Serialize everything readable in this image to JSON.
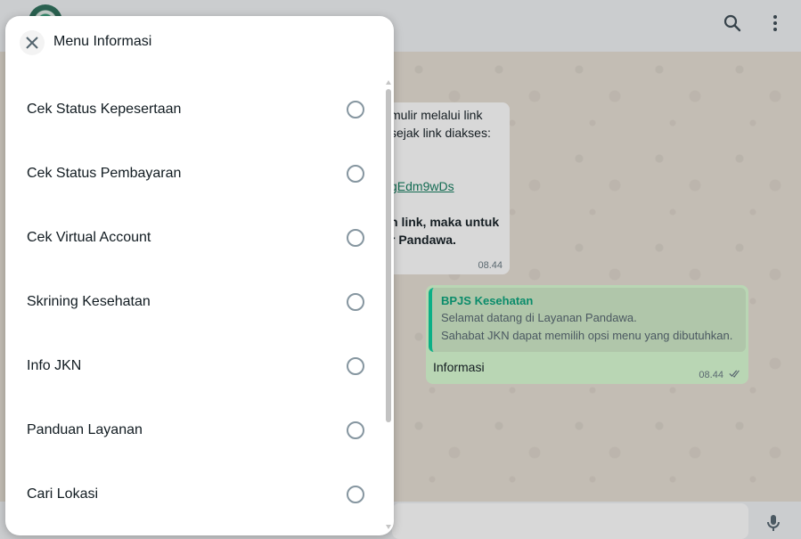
{
  "chat": {
    "incoming": {
      "lines": [
        "mulir melalui link",
        "sejak link diakses:",
        "gEdm9wDs",
        "n link, maka untuk",
        "r Pandawa."
      ],
      "time": "08.44"
    },
    "outgoing": {
      "quote_title": "BPJS Kesehatan",
      "quote_line1": "Selamat datang di Layanan Pandawa.",
      "quote_line2": "Sahabat JKN dapat memilih opsi menu yang dibutuhkan.",
      "message": "Informasi",
      "time": "08.44"
    }
  },
  "modal": {
    "title": "Menu Informasi",
    "options": [
      {
        "label": "Cek Status Kepesertaan"
      },
      {
        "label": "Cek Status Pembayaran"
      },
      {
        "label": "Cek Virtual Account"
      },
      {
        "label": "Skrining Kesehatan"
      },
      {
        "label": "Info JKN"
      },
      {
        "label": "Panduan Layanan"
      },
      {
        "label": "Cari Lokasi"
      }
    ]
  },
  "icons": {
    "close": "close-icon",
    "search": "search-icon",
    "menu": "more-vertical-icon",
    "mic": "microphone-icon",
    "ticks": "double-check-icon"
  },
  "colors": {
    "accent": "#06cf9c",
    "outgoing_bubble": "#d9fdd3",
    "radio_border": "#8696a0"
  }
}
